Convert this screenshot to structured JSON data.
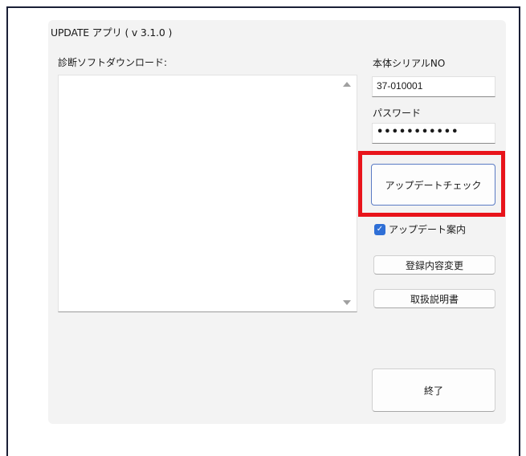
{
  "window": {
    "title": "UPDATE アプリ ( v 3.1.0 )"
  },
  "download": {
    "label": "診断ソフトダウンロード:",
    "items": []
  },
  "serial": {
    "label": "本体シリアルNO",
    "value": "37-010001"
  },
  "password": {
    "label": "パスワード",
    "masked_value": "•••••••••••"
  },
  "buttons": {
    "update_check": "アップデートチェック",
    "register_change": "登録内容変更",
    "manual": "取扱説明書",
    "exit": "終了"
  },
  "checkbox": {
    "label": "アップデート案内",
    "checked": true
  },
  "colors": {
    "highlight": "#e8141b",
    "accent": "#2f6fd6"
  }
}
